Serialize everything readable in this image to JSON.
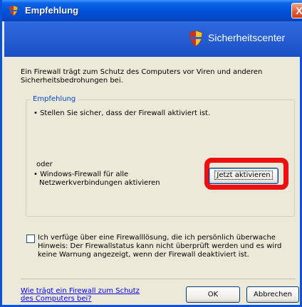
{
  "window": {
    "title": "Empfehlung",
    "close_glyph": "X"
  },
  "banner": {
    "title": "Sicherheitscenter",
    "icon": "shield-icon"
  },
  "intro": {
    "text": "Ein Firewall trägt zum Schutz des Computers vor Viren und anderen Sicherheitsbedrohungen bei."
  },
  "recommendation": {
    "legend": "Empfehlung",
    "bullet1": "• Stellen Sie sicher, dass der Firewall aktiviert ist.",
    "or_label": "oder",
    "bullet2_line1": "• Windows-Firewall für alle",
    "bullet2_line2": "Netzwerkverbindungen aktivieren",
    "activate_button": "Jetzt aktivieren",
    "highlight_color": "#ee1010"
  },
  "checkbox": {
    "checked": false,
    "label": "Ich verfüge über eine Firewalllösung, die ich persönlich überwache Hinweis: Der Firewallstatus kann nicht überprüft werden und es wird keine Warnung angezeigt, wenn der Firewall deaktiviert ist."
  },
  "footer": {
    "link_line1": "Wie trägt ein Firewall zum Schutz",
    "link_line2": "des Computers bei?",
    "ok_label": "OK",
    "cancel_label": "Abbrechen"
  },
  "colors": {
    "titlebar": "#0051d8",
    "dialog_bg": "#ece9d8",
    "legend_text": "#0046d5",
    "link": "#0000ee"
  }
}
